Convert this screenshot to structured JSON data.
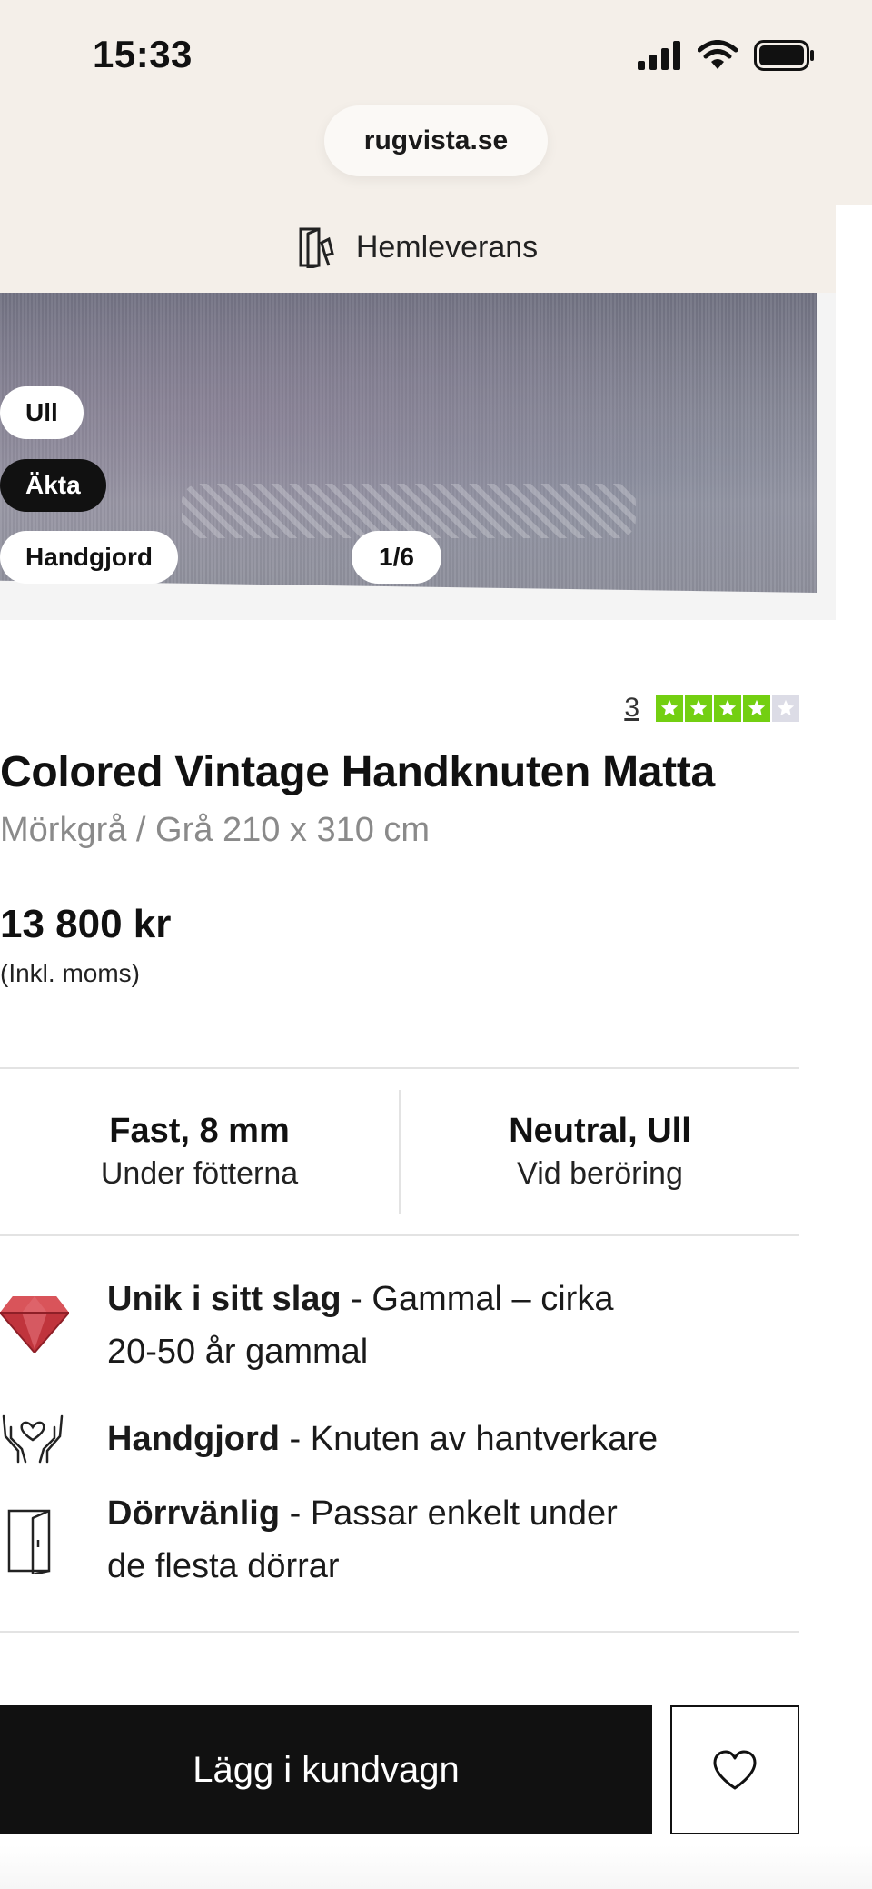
{
  "status_bar": {
    "time": "15:33"
  },
  "browser": {
    "url": "rugvista.se"
  },
  "delivery": {
    "label": "Hemleverans"
  },
  "gallery": {
    "badges": [
      "Ull",
      "Äkta",
      "Handgjord"
    ],
    "counter": "1/6"
  },
  "rating": {
    "count": "3",
    "stars": 4,
    "max_stars": 5,
    "star_color": "#73cf11"
  },
  "product": {
    "title": "Colored Vintage Handknuten Matta",
    "subtitle": "Mörkgrå / Grå 210 x 310 cm",
    "price": "13 800 kr",
    "vat": "(Inkl. moms)"
  },
  "specs": [
    {
      "title": "Fast, 8 mm",
      "sub": "Under fötterna"
    },
    {
      "title": "Neutral, Ull",
      "sub": "Vid beröring"
    }
  ],
  "features": [
    {
      "icon": "gem-icon",
      "bold": "Unik i sitt slag",
      "line1": " - Gammal – cirka",
      "line2": "20-50 år gammal"
    },
    {
      "icon": "heart-hands-icon",
      "bold": "Handgjord",
      "line1": " - Knuten av hantverkare",
      "line2": ""
    },
    {
      "icon": "door-icon",
      "bold": "Dörrvänlig",
      "line1": " - Passar enkelt under",
      "line2": "de flesta dörrar"
    }
  ],
  "actions": {
    "add_to_cart": "Lägg i kundvagn",
    "wishlist_icon": "heart-outline-icon"
  }
}
